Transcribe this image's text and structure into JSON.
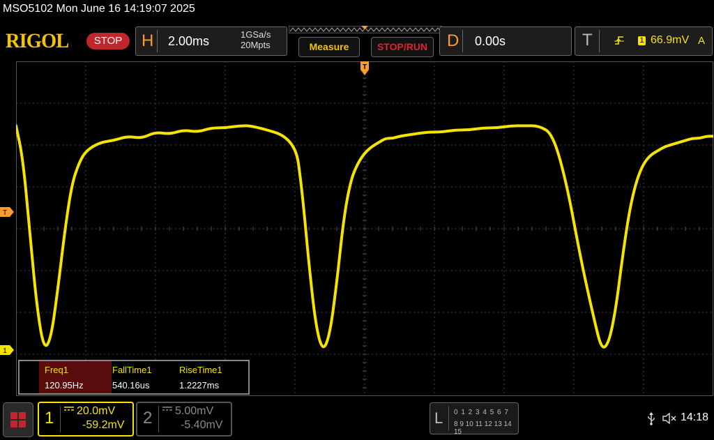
{
  "title_line": "MSO5102  Mon June 16 14:19:07 2025",
  "brand": {
    "logo": "RIGOL",
    "run_state": "STOP"
  },
  "horizontal": {
    "letter": "H",
    "scale": "2.00ms",
    "sample_rate": "1GSa/s",
    "memory_depth": "20Mpts"
  },
  "buttons": {
    "measure": "Measure",
    "stop_run": "STOP/RUN"
  },
  "delay": {
    "letter": "D",
    "value": "0.00s"
  },
  "trigger": {
    "letter": "T",
    "source": "1",
    "level": "66.9mV",
    "mode": "A",
    "marker": "T"
  },
  "measurements": [
    {
      "label": "Freq1",
      "value": "120.95Hz"
    },
    {
      "label": "FallTime1",
      "value": "540.16us"
    },
    {
      "label": "RiseTime1",
      "value": "1.2227ms"
    }
  ],
  "channel1": {
    "number": "1",
    "scale": "20.0mV",
    "offset": "-59.2mV",
    "marker": "1"
  },
  "channel2": {
    "number": "2",
    "scale": "5.00mV",
    "offset": "-5.40mV"
  },
  "logic": {
    "letter": "L",
    "row1": "0 1 2 3   4 5 6 7",
    "row2": "8 9 10 11 12 13 14 15"
  },
  "status": {
    "time": "14:18"
  },
  "icons": [
    "menu-icon",
    "usb-icon",
    "speaker-muted-icon",
    "trigger-rising-edge-icon",
    "dc-coupling-icon"
  ],
  "colors": {
    "ch1": "#f5e400",
    "accent_orange": "#ff9b2e",
    "stop_red": "#c0272d",
    "logo_yellow": "#f5c400"
  },
  "chart_data": {
    "type": "line",
    "title": "",
    "xlabel": "",
    "ylabel": "",
    "x_divisions": 10,
    "y_divisions": 8,
    "xlim_ms": [
      -10,
      10
    ],
    "ylim_mV": [
      -139.2,
      20.8
    ],
    "grid": true,
    "series": [
      {
        "x_ms": [
          -10.0,
          -9.8,
          -9.6,
          -9.4,
          -9.2,
          -9.0,
          -8.8,
          -8.6,
          -8.4,
          -8.2,
          -8.0,
          -7.6,
          -7.2,
          -6.8,
          -6.4,
          -6.0,
          -5.6,
          -5.2,
          -4.8,
          -4.4,
          -4.0,
          -3.6,
          -3.2,
          -2.0,
          -1.8,
          -1.6,
          -1.4,
          -1.2,
          -1.0,
          -0.8,
          -0.6,
          -0.4,
          -0.2,
          0.0,
          0.2,
          0.4,
          0.6,
          0.8,
          1.0,
          1.4,
          1.8,
          2.2,
          2.6,
          3.0,
          3.4,
          3.8,
          4.2,
          4.6,
          5.0,
          5.4,
          5.8,
          6.2,
          6.6,
          6.8,
          7.0,
          7.2,
          7.4,
          7.6,
          7.8,
          8.0,
          8.2,
          8.4,
          8.6,
          8.8,
          9.0,
          9.2,
          9.4,
          9.6,
          9.8,
          10.0
        ],
        "y_mV": [
          -10,
          -26,
          -62,
          -97,
          -117,
          -112,
          -88,
          -60,
          -38,
          -28,
          -22,
          -18,
          -17,
          -15,
          -16,
          -13,
          -14,
          -12,
          -13,
          -11,
          -11,
          -10,
          -10,
          -16,
          -40,
          -76,
          -106,
          -118,
          -110,
          -85,
          -54,
          -36,
          -28,
          -23,
          -20,
          -18,
          -16,
          -16,
          -15,
          -14,
          -13,
          -13,
          -12,
          -12,
          -11,
          -11,
          -10,
          -10,
          -10,
          -14,
          -38,
          -74,
          -104,
          -117,
          -114,
          -98,
          -72,
          -50,
          -36,
          -28,
          -24,
          -22,
          -20,
          -19,
          -18,
          -17,
          -16,
          -16,
          -15,
          -15
        ]
      }
    ]
  }
}
